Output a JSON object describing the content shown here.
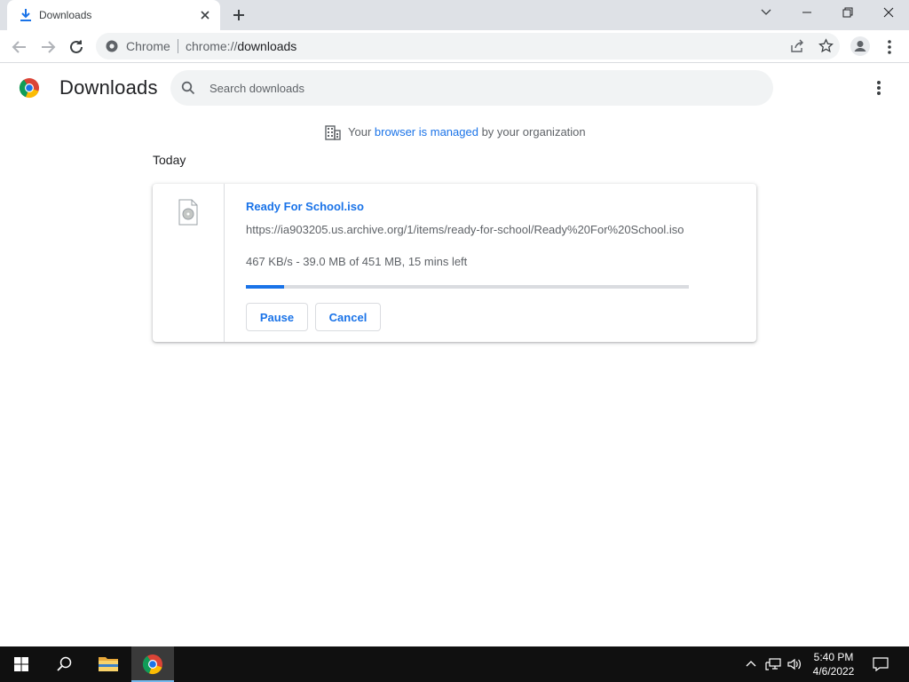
{
  "tab": {
    "title": "Downloads"
  },
  "toolbar": {
    "site_chip": "Chrome",
    "url_scheme": "chrome://",
    "url_path": "downloads"
  },
  "page": {
    "title": "Downloads",
    "search_placeholder": "Search downloads",
    "managed": {
      "prefix": "Your ",
      "link": "browser is managed",
      "suffix": " by your organization"
    },
    "date_header": "Today"
  },
  "download": {
    "file_name": "Ready For School.iso",
    "url": "https://ia903205.us.archive.org/1/items/ready-for-school/Ready%20For%20School.iso",
    "status": "467 KB/s - 39.0 MB of 451 MB, 15 mins left",
    "progress_fraction": 0.0865,
    "pause_label": "Pause",
    "cancel_label": "Cancel"
  },
  "colors": {
    "accent": "#1a73e8",
    "tab_strip": "#dee1e6",
    "omnibox": "#f1f3f4",
    "taskbar": "#101010"
  },
  "taskbar": {
    "time": "5:40 PM",
    "date": "4/6/2022"
  }
}
